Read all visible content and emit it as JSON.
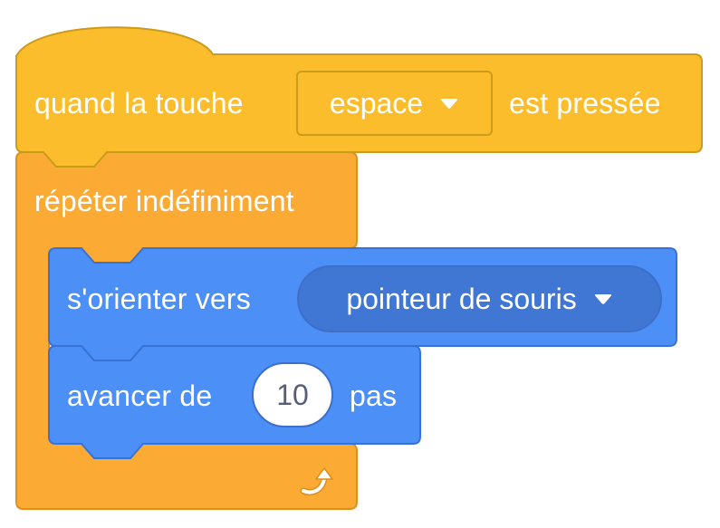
{
  "colors": {
    "events": "#fbbd2c",
    "events_border": "#cc9b1c",
    "control": "#fbab33",
    "control_border": "#dd8f1c",
    "motion": "#4c8ff7",
    "motion_border": "#3773d6",
    "motion_dropdown": "#4177d4",
    "input_text": "#575e75"
  },
  "hat_block": {
    "label_before": "quand la touche",
    "key_dropdown": {
      "value": "espace",
      "icon": "caret-down-icon"
    },
    "label_after": "est pressée"
  },
  "forever_block": {
    "label": "répéter indéfiniment",
    "loop_icon": "loop-arrow-icon"
  },
  "point_towards_block": {
    "label": "s'orienter vers",
    "target_dropdown": {
      "value": "pointeur de souris",
      "icon": "caret-down-icon"
    }
  },
  "move_block": {
    "label_before": "avancer de",
    "steps_input": {
      "value": "10"
    },
    "label_after": "pas"
  }
}
